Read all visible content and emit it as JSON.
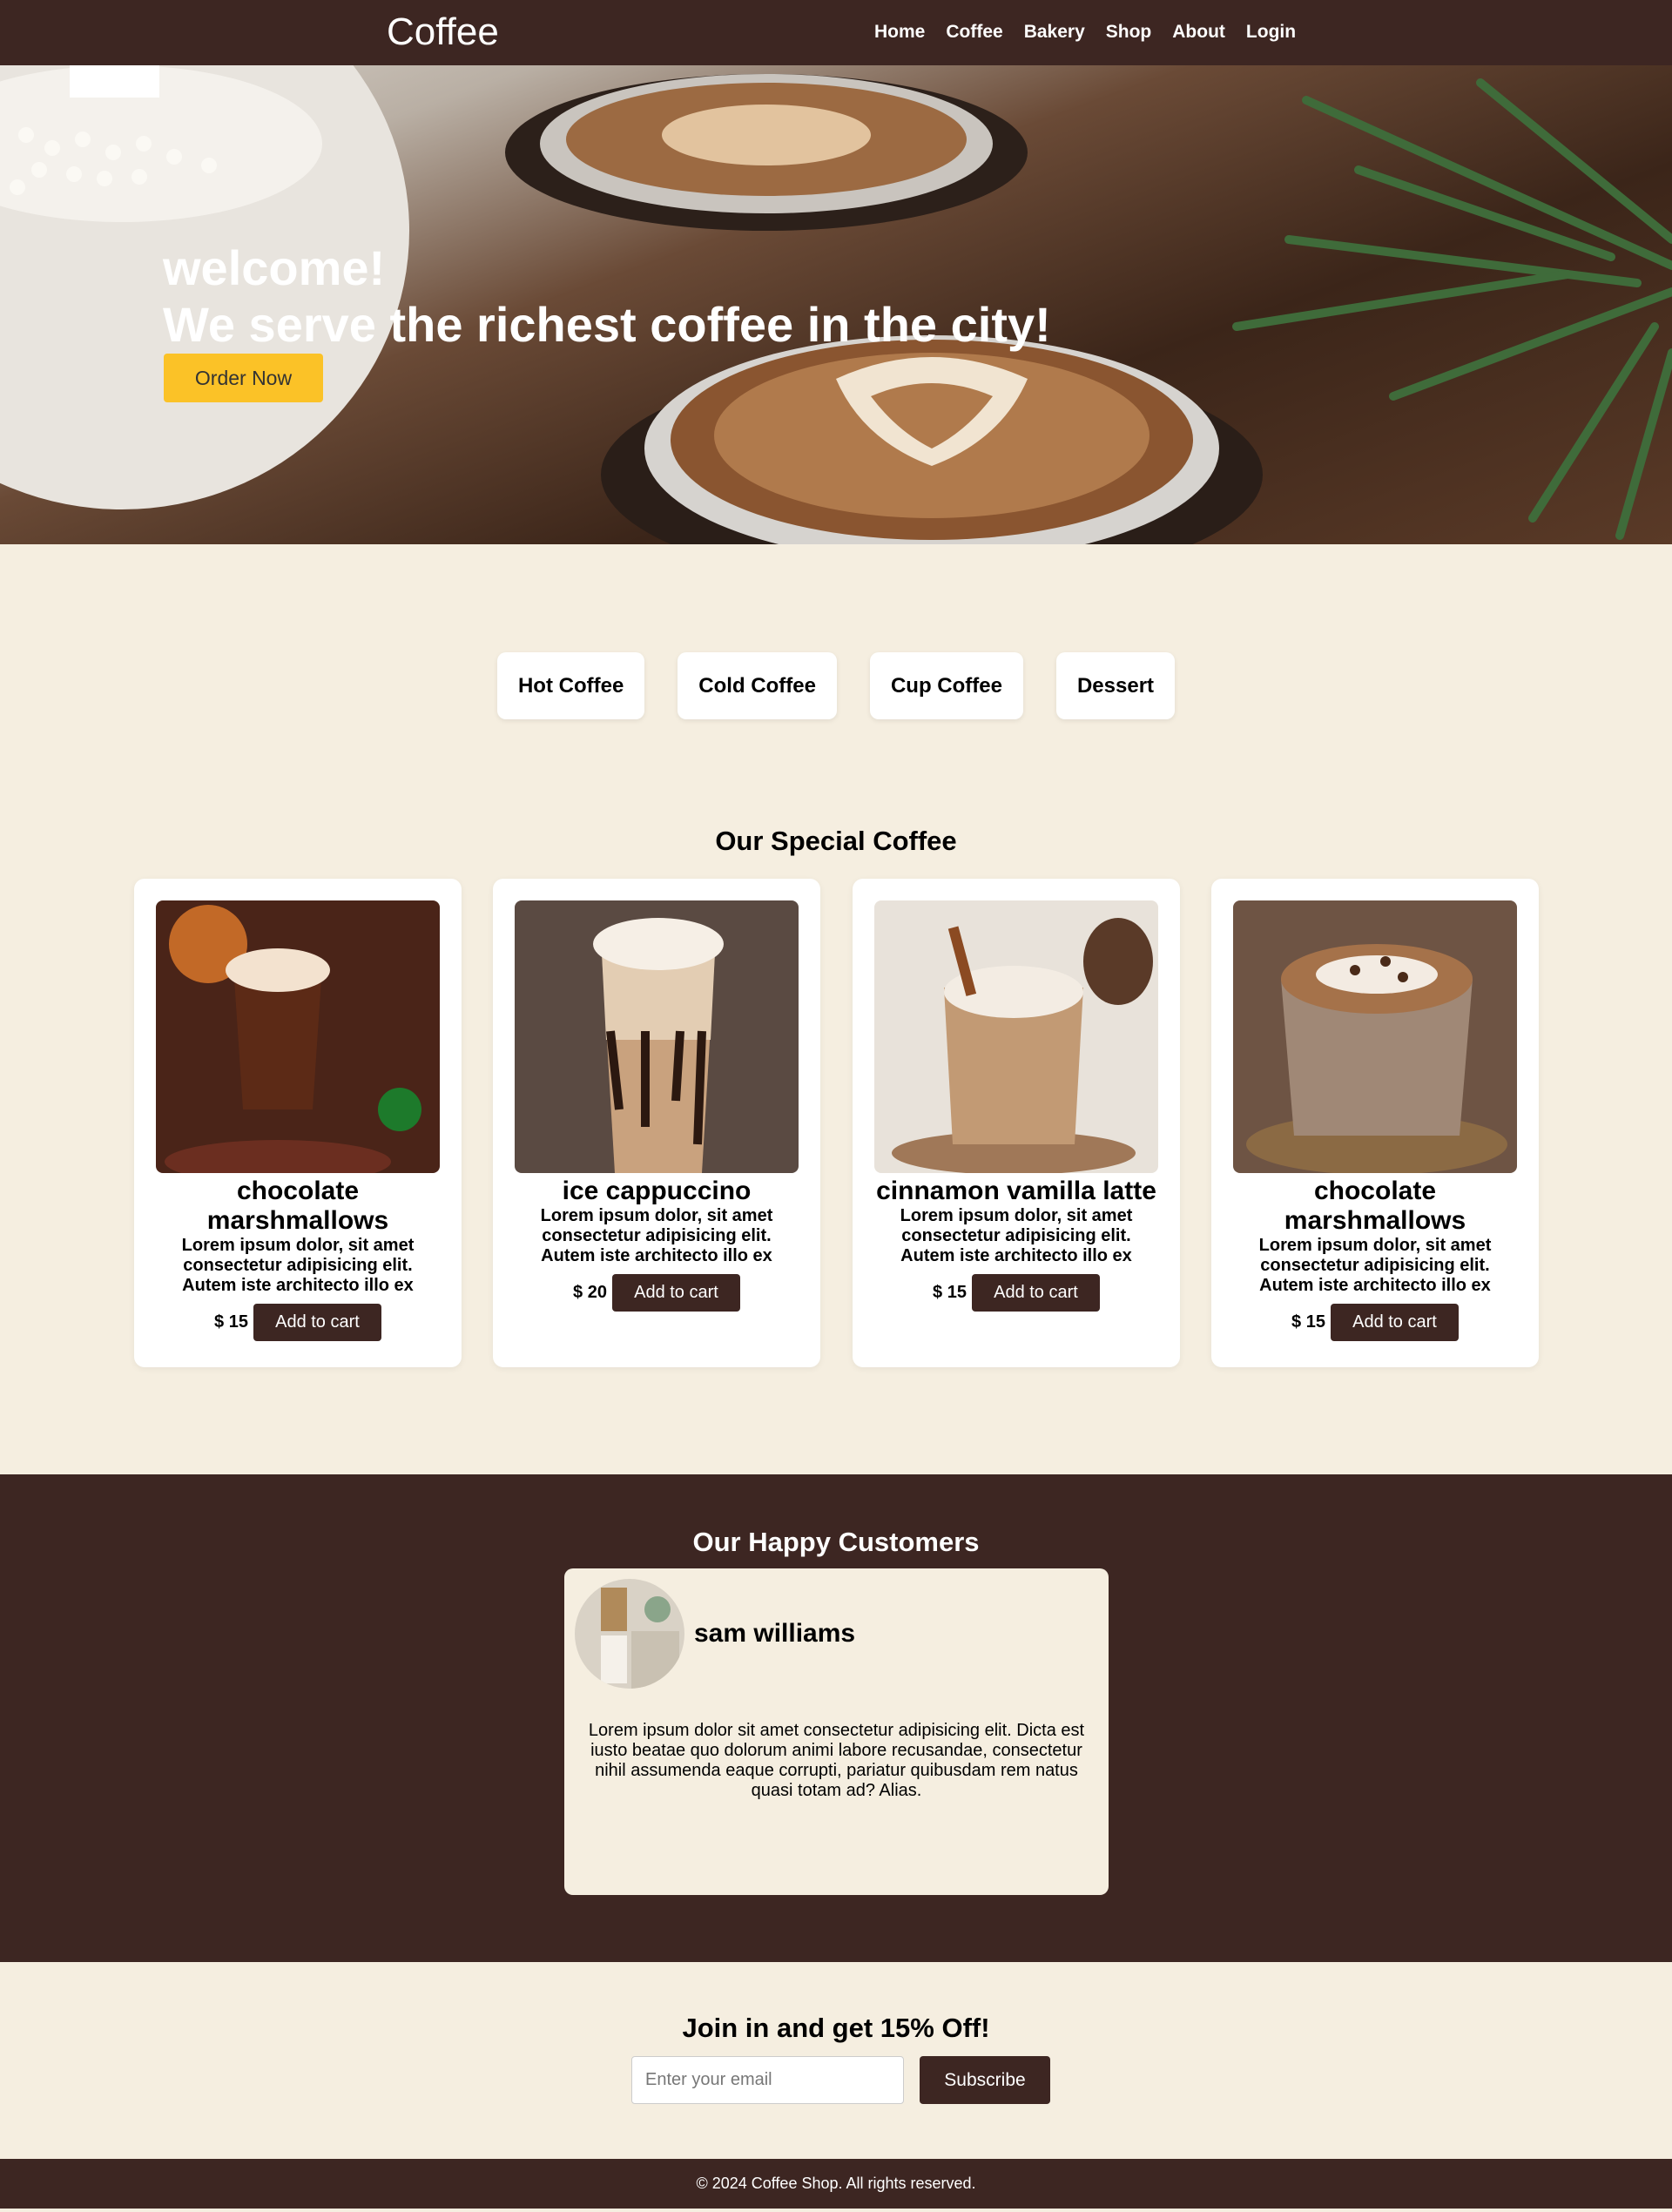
{
  "nav": {
    "brand": "Coffee",
    "links": [
      "Home",
      "Coffee",
      "Bakery",
      "Shop",
      "About",
      "Login"
    ]
  },
  "hero": {
    "welcome": "welcome!",
    "headline": "We serve the richest coffee in the city!",
    "order_button": "Order Now"
  },
  "categories": [
    "Hot Coffee",
    "Cold Coffee",
    "Cup Coffee",
    "Dessert"
  ],
  "special": {
    "title": "Our Special Coffee",
    "items": [
      {
        "name": "chocolate marshmallows",
        "desc": "Lorem ipsum dolor, sit amet consectetur adipisicing elit. Autem iste architecto illo ex",
        "price": "$ 15",
        "button": "Add to cart"
      },
      {
        "name": "ice cappuccino",
        "desc": "Lorem ipsum dolor, sit amet consectetur adipisicing elit. Autem iste architecto illo ex",
        "price": "$ 20",
        "button": "Add to cart"
      },
      {
        "name": "cinnamon vamilla latte",
        "desc": "Lorem ipsum dolor, sit amet consectetur adipisicing elit. Autem iste architecto illo ex",
        "price": "$ 15",
        "button": "Add to cart"
      },
      {
        "name": "chocolate marshmallows",
        "desc": "Lorem ipsum dolor, sit amet consectetur adipisicing elit. Autem iste architecto illo ex",
        "price": "$ 15",
        "button": "Add to cart"
      }
    ]
  },
  "customers": {
    "title": "Our Happy Customers",
    "review": {
      "name": "sam williams",
      "text": "Lorem ipsum dolor sit amet consectetur adipisicing elit. Dicta est iusto beatae quo dolorum animi labore recusandae, consectetur nihil assumenda eaque corrupti, pariatur quibusdam rem natus quasi totam ad? Alias."
    }
  },
  "newsletter": {
    "title": "Join in and get 15% Off!",
    "placeholder": "Enter your email",
    "button": "Subscribe"
  },
  "footer": {
    "text": "© 2024 Coffee Shop. All rights reserved."
  },
  "colors": {
    "brand_dark": "#3d2622",
    "cream": "#f5eee0",
    "accent": "#fbc227"
  }
}
